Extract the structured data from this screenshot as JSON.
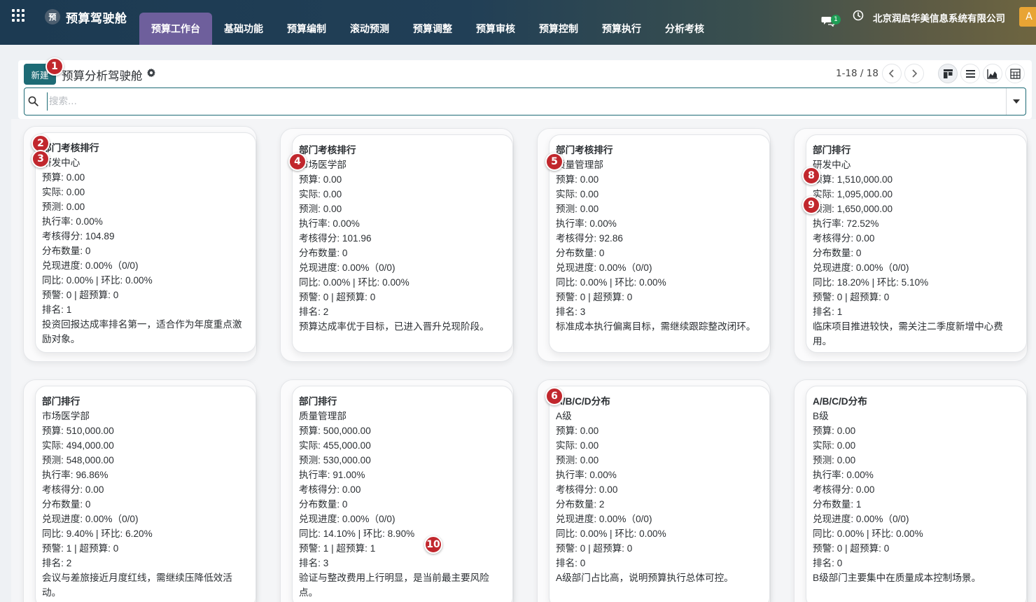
{
  "navbar": {
    "brand_logo_text": "预",
    "brand_name": "预算驾驶舱",
    "menu": [
      {
        "label": "预算工作台",
        "active": true
      },
      {
        "label": "基础功能",
        "active": false
      },
      {
        "label": "预算编制",
        "active": false
      },
      {
        "label": "滚动预测",
        "active": false
      },
      {
        "label": "预算调整",
        "active": false
      },
      {
        "label": "预算审核",
        "active": false
      },
      {
        "label": "预算控制",
        "active": false
      },
      {
        "label": "预算执行",
        "active": false
      },
      {
        "label": "分析考核",
        "active": false
      }
    ],
    "chat_badge": "1",
    "company": "北京润启华美信息系统有限公司",
    "avatar": "A",
    "accent_color": "#6e5f9c"
  },
  "control_panel": {
    "new_label": "新建",
    "title": "预算分析驾驶舱",
    "pager_value": "1-18 / 18",
    "search_placeholder": "搜索...",
    "brand_color": "#1d6b75"
  },
  "cards": [
    {
      "title": "部门考核排行",
      "subject": "研发中心",
      "budget": "预算: 0.00",
      "actual": "实际: 0.00",
      "forecast": "预测: 0.00",
      "exec_rate": "执行率: 0.00%",
      "score": "考核得分: 104.89",
      "dist_count": "分布数量: 0",
      "redeem": "兑现进度: 0.00%（0/0)",
      "yoy": "同比: 0.00% | 环比: 0.00%",
      "warn": "预警: 0 | 超预算: 0",
      "rank": "排名: 1",
      "note": "投资回报达成率排名第一，适合作为年度重点激励对象。"
    },
    {
      "title": "部门考核排行",
      "subject": "市场医学部",
      "budget": "预算: 0.00",
      "actual": "实际: 0.00",
      "forecast": "预测: 0.00",
      "exec_rate": "执行率: 0.00%",
      "score": "考核得分: 101.96",
      "dist_count": "分布数量: 0",
      "redeem": "兑现进度: 0.00%（0/0)",
      "yoy": "同比: 0.00% | 环比: 0.00%",
      "warn": "预警: 0 | 超预算: 0",
      "rank": "排名: 2",
      "note": "预算达成率优于目标，已进入晋升兑现阶段。"
    },
    {
      "title": "部门考核排行",
      "subject": "质量管理部",
      "budget": "预算: 0.00",
      "actual": "实际: 0.00",
      "forecast": "预测: 0.00",
      "exec_rate": "执行率: 0.00%",
      "score": "考核得分: 92.86",
      "dist_count": "分布数量: 0",
      "redeem": "兑现进度: 0.00%（0/0)",
      "yoy": "同比: 0.00% | 环比: 0.00%",
      "warn": "预警: 0 | 超预算: 0",
      "rank": "排名: 3",
      "note": "标准成本执行偏离目标，需继续跟踪整改闭环。"
    },
    {
      "title": "部门排行",
      "subject": "研发中心",
      "budget": "预算: 1,510,000.00",
      "actual": "实际: 1,095,000.00",
      "forecast": "预测: 1,650,000.00",
      "exec_rate": "执行率: 72.52%",
      "score": "考核得分: 0.00",
      "dist_count": "分布数量: 0",
      "redeem": "兑现进度: 0.00%（0/0)",
      "yoy": "同比: 18.20% | 环比: 5.10%",
      "warn": "预警: 0 | 超预算: 0",
      "rank": "排名: 1",
      "note": "临床项目推进较快，需关注二季度新增中心费用。"
    },
    {
      "title": "部门排行",
      "subject": "市场医学部",
      "budget": "预算: 510,000.00",
      "actual": "实际: 494,000.00",
      "forecast": "预测: 548,000.00",
      "exec_rate": "执行率: 96.86%",
      "score": "考核得分: 0.00",
      "dist_count": "分布数量: 0",
      "redeem": "兑现进度: 0.00%（0/0)",
      "yoy": "同比: 9.40% | 环比: 6.20%",
      "warn": "预警: 1 | 超预算: 0",
      "rank": "排名: 2",
      "note": "会议与差旅接近月度红线，需继续压降低效活动。"
    },
    {
      "title": "部门排行",
      "subject": "质量管理部",
      "budget": "预算: 500,000.00",
      "actual": "实际: 455,000.00",
      "forecast": "预测: 530,000.00",
      "exec_rate": "执行率: 91.00%",
      "score": "考核得分: 0.00",
      "dist_count": "分布数量: 0",
      "redeem": "兑现进度: 0.00%（0/0)",
      "yoy": "同比: 14.10% | 环比: 8.90%",
      "warn": "预警: 1 | 超预算: 1",
      "rank": "排名: 3",
      "note": "验证与整改费用上行明显，是当前最主要风险点。"
    },
    {
      "title": "A/B/C/D分布",
      "subject": "A级",
      "budget": "预算: 0.00",
      "actual": "实际: 0.00",
      "forecast": "预测: 0.00",
      "exec_rate": "执行率: 0.00%",
      "score": "考核得分: 0.00",
      "dist_count": "分布数量: 2",
      "redeem": "兑现进度: 0.00%（0/0)",
      "yoy": "同比: 0.00% | 环比: 0.00%",
      "warn": "预警: 0 | 超预算: 0",
      "rank": "排名: 0",
      "note": "A级部门占比高，说明预算执行总体可控。"
    },
    {
      "title": "A/B/C/D分布",
      "subject": "B级",
      "budget": "预算: 0.00",
      "actual": "实际: 0.00",
      "forecast": "预测: 0.00",
      "exec_rate": "执行率: 0.00%",
      "score": "考核得分: 0.00",
      "dist_count": "分布数量: 1",
      "redeem": "兑现进度: 0.00%（0/0)",
      "yoy": "同比: 0.00% | 环比: 0.00%",
      "warn": "预警: 0 | 超预算: 0",
      "rank": "排名: 0",
      "note": "B级部门主要集中在质量成本控制场景。"
    }
  ],
  "markers": [
    "1",
    "2",
    "3",
    "4",
    "5",
    "6",
    "8",
    "9",
    "10"
  ],
  "marker_color": "#c1272d"
}
